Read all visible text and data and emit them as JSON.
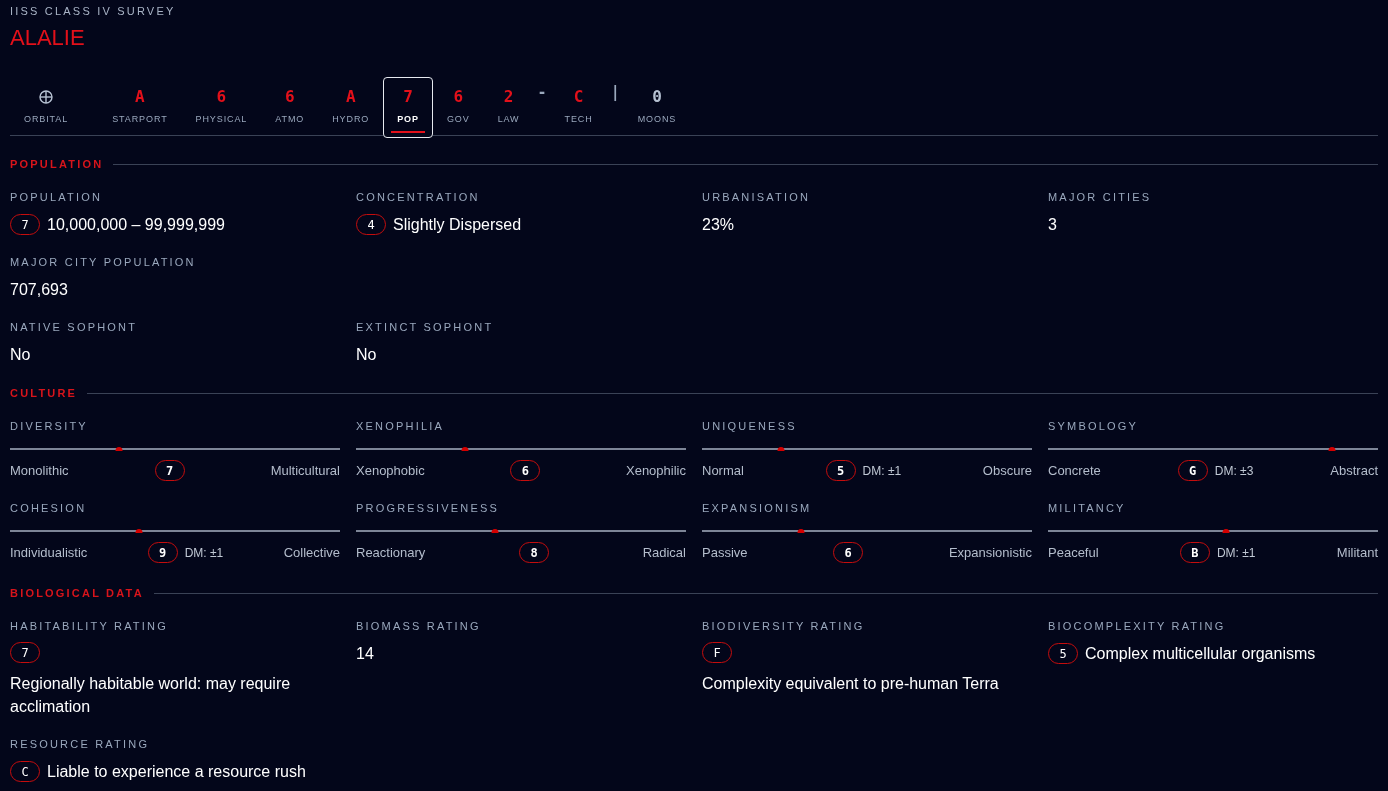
{
  "survey": {
    "subtitle": "IISS CLASS IV SURVEY",
    "world_name": "ALALIE"
  },
  "profile_tabs": [
    {
      "kind": "icon",
      "label": "ORBITAL",
      "selected": false
    },
    {
      "kind": "code",
      "value": "A",
      "label": "STARPORT",
      "selected": false
    },
    {
      "kind": "code",
      "value": "6",
      "label": "PHYSICAL",
      "selected": false
    },
    {
      "kind": "code",
      "value": "6",
      "label": "ATMO",
      "selected": false
    },
    {
      "kind": "code",
      "value": "A",
      "label": "HYDRO",
      "selected": false
    },
    {
      "kind": "code",
      "value": "7",
      "label": "POP",
      "selected": true
    },
    {
      "kind": "code",
      "value": "6",
      "label": "GOV",
      "selected": false
    },
    {
      "kind": "code",
      "value": "2",
      "label": "LAW",
      "selected": false
    },
    {
      "kind": "code",
      "value": "C",
      "label": "TECH",
      "selected": false,
      "separator_before": "-"
    },
    {
      "kind": "count",
      "value": "0",
      "label": "MOONS",
      "selected": false,
      "separator_before": "|"
    }
  ],
  "sections": [
    {
      "kind": "fields",
      "title": "POPULATION",
      "rows": [
        [
          {
            "label": "POPULATION",
            "code": "7",
            "value": "10,000,000 – 99,999,999"
          },
          {
            "label": "CONCENTRATION",
            "code": "4",
            "value": "Slightly Dispersed"
          },
          {
            "label": "URBANISATION",
            "value": "23%"
          },
          {
            "label": "MAJOR CITIES",
            "value": "3"
          }
        ],
        [
          {
            "label": "MAJOR CITY POPULATION",
            "value": "707,693"
          }
        ],
        [
          {
            "label": "NATIVE SOPHONT",
            "value": "No"
          },
          {
            "label": "EXTINCT SOPHONT",
            "value": "No"
          }
        ]
      ]
    },
    {
      "kind": "sliders",
      "title": "CULTURE",
      "sliders": [
        {
          "label": "DIVERSITY",
          "level": 0.33,
          "low": "Monolithic",
          "high": "Multicultural",
          "code": "7"
        },
        {
          "label": "XENOPHILIA",
          "level": 0.33,
          "low": "Xenophobic",
          "high": "Xenophilic",
          "code": "6"
        },
        {
          "label": "UNIQUENESS",
          "level": 0.24,
          "low": "Normal",
          "high": "Obscure",
          "code": "5",
          "dm": "DM: ±1"
        },
        {
          "label": "SYMBOLOGY",
          "level": 0.86,
          "low": "Concrete",
          "high": "Abstract",
          "code": "G",
          "dm": "DM: ±3"
        },
        {
          "label": "COHESION",
          "level": 0.39,
          "low": "Individualistic",
          "high": "Collective",
          "code": "9",
          "dm": "DM: ±1"
        },
        {
          "label": "PROGRESSIVENESS",
          "level": 0.42,
          "low": "Reactionary",
          "high": "Radical",
          "code": "8"
        },
        {
          "label": "EXPANSIONISM",
          "level": 0.3,
          "low": "Passive",
          "high": "Expansionistic",
          "code": "6"
        },
        {
          "label": "MILITANCY",
          "level": 0.54,
          "low": "Peaceful",
          "high": "Militant",
          "code": "B",
          "dm": "DM: ±1"
        }
      ]
    },
    {
      "kind": "fields",
      "title": "BIOLOGICAL DATA",
      "rows": [
        [
          {
            "label": "HABITABILITY RATING",
            "code": "7",
            "value": "Regionally habitable world: may require acclimation"
          },
          {
            "label": "BIOMASS RATING",
            "value": "14"
          },
          {
            "label": "BIODIVERSITY RATING",
            "code": "F",
            "value": "Complexity equivalent to pre-human Terra"
          },
          {
            "label": "BIOCOMPLEXITY RATING",
            "code": "5",
            "value": "Complex multicellular organisms"
          }
        ],
        [
          {
            "label": "RESOURCE RATING",
            "code": "C",
            "value": "Liable to experience a resource rush"
          }
        ]
      ]
    }
  ]
}
